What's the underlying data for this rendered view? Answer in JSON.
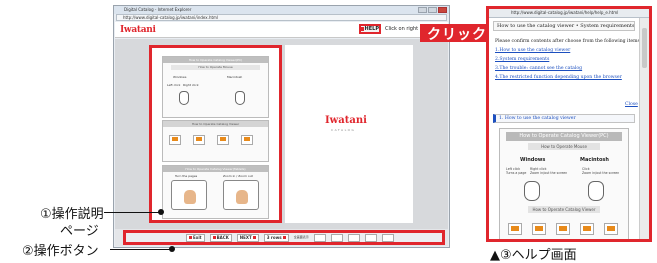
{
  "browser": {
    "title": "Digital Catalog - Internet Explorer",
    "url": "http://www.digital-catalog.jp/iwatani/index.html",
    "logo": "Iwatani",
    "help_button": "HELP",
    "click_on_right": "Click on right",
    "right_logo": "Iwatani",
    "right_logo_sub": "CATALOG"
  },
  "manual_page": {
    "header_pc": "How to Operate Catalog Viewer(PC)",
    "sub_mouse": "How to Operate Mouse",
    "windows": "Windows",
    "macintosh": "Macintosh",
    "left_click": "Left click",
    "right_click": "Right click",
    "header_viewer": "How to Operate Catalog Viewer",
    "header_tablet": "How to Operate Catalog Viewer(Tablets)",
    "turn_pages": "Turn the pages",
    "zoom": "Zoom in / Zoom out"
  },
  "toolbar": {
    "exit": "Exit",
    "back": "BACK",
    "next": "NEXT",
    "frame": "3 rows",
    "zoom": "全画面表示"
  },
  "callouts": {
    "manual_line1": "①操作説明",
    "manual_line2": "ページ",
    "toolbar": "②操作ボタン",
    "click": "クリック",
    "help": "▲③ヘルプ画面"
  },
  "help_window": {
    "url": "http://www.digital-catalog.jp/iwatani/help/help_e.html",
    "title": "How to use the catalog viewer • System requirements",
    "intro": "Please confirm contents after choose from the following items.",
    "links": [
      "1.How to use the catalog viewer",
      "2.System requirements",
      "3.The trouble: cannot see the catalog",
      "4.The restricted function depending upon the browser"
    ],
    "close": "Close",
    "section": "1. How to use the catalog viewer",
    "guide_header": "How to Operate Catalog Viewer(PC)",
    "guide_sub": "How to Operate Mouse",
    "windows": "Windows",
    "macintosh": "Macintosh",
    "win_left": "Left click",
    "win_left_desc": "Turns a page",
    "win_right": "Right click",
    "win_right_desc": "Zoom in/out the screen",
    "mac_click": "Click",
    "mac_click_desc": "Zoom in/out the screen",
    "guide_viewer": "How to Operate Catalog Viewer"
  },
  "colors": {
    "accent_red": "#e0262d",
    "link_blue": "#1c4fbf"
  }
}
